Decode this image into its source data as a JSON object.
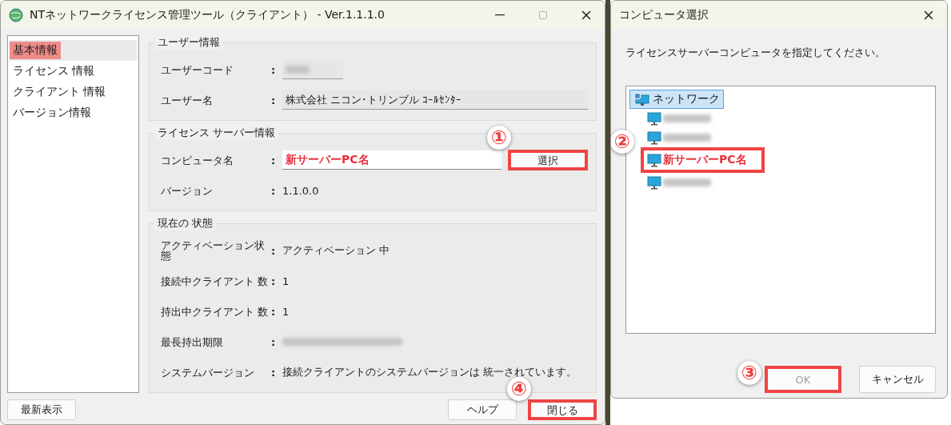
{
  "main_window": {
    "title": "NTネットワークライセンス管理ツール（クライアント） - Ver.1.1.1.0",
    "sidebar": {
      "items": [
        {
          "label": "基本情報",
          "selected": true
        },
        {
          "label": "ライセンス 情報",
          "selected": false
        },
        {
          "label": "クライアント 情報",
          "selected": false
        },
        {
          "label": "バージョン情報",
          "selected": false
        }
      ]
    },
    "sections": [
      {
        "title": "ユーザー情報",
        "rows": [
          {
            "label": "ユーザーコード",
            "separator": ":",
            "kind": "redacted_field"
          },
          {
            "label": "ユーザー名",
            "separator": ":",
            "kind": "field",
            "value": "株式会社 ニコン･トリンブル ｺｰﾙｾﾝﾀｰ"
          }
        ]
      },
      {
        "title": "ライセンス サーバー情報",
        "rows": [
          {
            "label": "コンピュータ名",
            "separator": ":",
            "kind": "input",
            "value": "新サーバーPC名",
            "button": {
              "label": "選択",
              "highlighted": true,
              "marker": "①"
            }
          },
          {
            "label": "バージョン",
            "separator": ":",
            "kind": "text",
            "value": "1.1.0.0"
          }
        ]
      },
      {
        "title": "現在の 状態",
        "rows": [
          {
            "label": "アクティベーション状態",
            "separator": ":",
            "kind": "text",
            "value": "アクティベーション 中"
          },
          {
            "label": "接続中クライアント 数",
            "separator": ":",
            "kind": "text",
            "value": "1"
          },
          {
            "label": "持出中クライアント 数",
            "separator": ":",
            "kind": "text",
            "value": "1"
          },
          {
            "label": "最長持出期限",
            "separator": ":",
            "kind": "redacted_text"
          },
          {
            "label": "システムバージョン",
            "separator": ":",
            "kind": "text",
            "value": "接続クライアントのシステムバージョンは 統一されています。"
          }
        ]
      }
    ],
    "footer": {
      "left_button": {
        "label": "最新表示",
        "highlighted": false
      },
      "right_buttons": [
        {
          "label": "ヘルプ",
          "highlighted": false
        },
        {
          "label": "閉じる",
          "highlighted": true,
          "marker": "④"
        }
      ]
    }
  },
  "dialog": {
    "title": "コンピュータ選択",
    "instruction": "ライセンスサーバーコンピュータを指定してください。",
    "tree": {
      "label": "ネットワーク",
      "selected": true,
      "children": [
        {
          "kind": "redacted",
          "highlighted": false
        },
        {
          "kind": "redacted",
          "highlighted": false
        },
        {
          "kind": "name",
          "label": "新サーバーPC名",
          "highlighted": true,
          "marker": "②"
        },
        {
          "kind": "redacted",
          "highlighted": false
        }
      ]
    },
    "buttons": [
      {
        "label": "OK",
        "disabled": true,
        "highlighted": true,
        "marker": "③"
      },
      {
        "label": "キャンセル",
        "disabled": false,
        "highlighted": false
      }
    ]
  }
}
